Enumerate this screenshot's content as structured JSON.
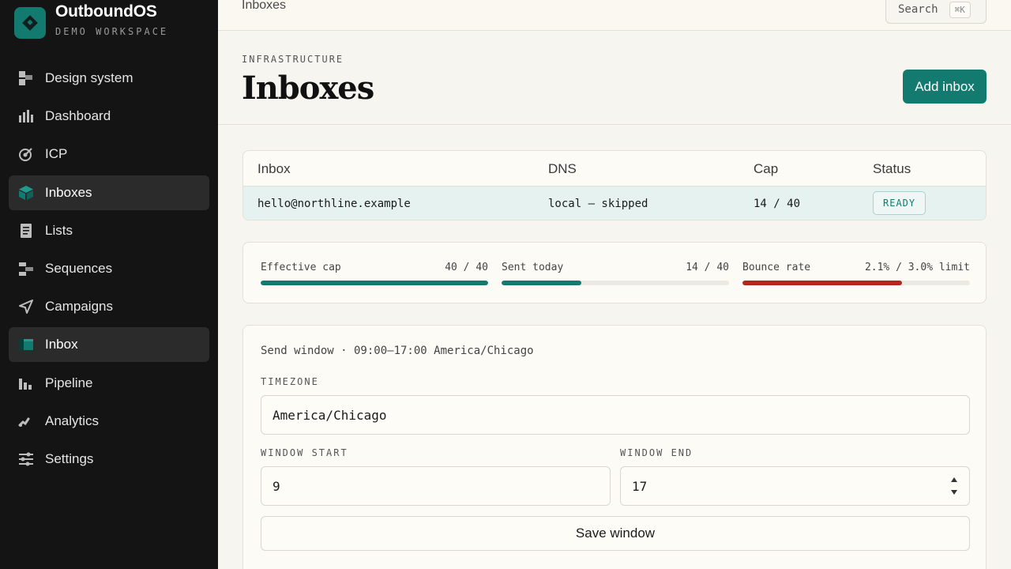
{
  "brand": {
    "name": "OutboundOS",
    "workspace": "DEMO WORKSPACE"
  },
  "sidebar": {
    "items": [
      {
        "label": "Design system",
        "icon": "design-system-icon"
      },
      {
        "label": "Dashboard",
        "icon": "bar-chart-icon"
      },
      {
        "label": "ICP",
        "icon": "target-icon"
      },
      {
        "label": "Inboxes",
        "icon": "inbox-box-icon",
        "active": true
      },
      {
        "label": "Lists",
        "icon": "document-icon"
      },
      {
        "label": "Sequences",
        "icon": "sequence-icon"
      },
      {
        "label": "Campaigns",
        "icon": "send-icon"
      },
      {
        "label": "Inbox",
        "icon": "inbox-tray-icon",
        "active": true
      },
      {
        "label": "Pipeline",
        "icon": "pipeline-icon"
      },
      {
        "label": "Analytics",
        "icon": "analytics-icon"
      },
      {
        "label": "Settings",
        "icon": "sliders-icon"
      }
    ]
  },
  "topbar": {
    "title": "Inboxes",
    "search_label": "Search",
    "search_shortcut": "⌘K"
  },
  "header": {
    "eyebrow": "INFRASTRUCTURE",
    "title": "Inboxes",
    "add_button": "Add inbox"
  },
  "table": {
    "columns": [
      "Inbox",
      "DNS",
      "Cap",
      "Status"
    ],
    "rows": [
      {
        "inbox": "hello@northline.example",
        "dns": "local — skipped",
        "cap": "14 / 40",
        "status": "READY"
      }
    ]
  },
  "metrics": [
    {
      "label": "Effective cap",
      "value": "40 / 40",
      "fraction": 1.0,
      "color": "#137a70"
    },
    {
      "label": "Sent today",
      "value": "14 / 40",
      "fraction": 0.35,
      "color": "#137a70"
    },
    {
      "label": "Bounce rate",
      "value": "2.1% / 3.0% limit",
      "fraction": 0.7,
      "color": "#b3261e"
    }
  ],
  "send_window": {
    "summary": "Send window · 09:00–17:00 America/Chicago",
    "timezone_label": "TIMEZONE",
    "timezone_value": "America/Chicago",
    "start_label": "WINDOW START",
    "start_value": "9",
    "end_label": "WINDOW END",
    "end_value": "17",
    "save_button": "Save window"
  },
  "colors": {
    "accent": "#137a70",
    "danger": "#b3261e",
    "sidebar_bg": "#141414"
  }
}
